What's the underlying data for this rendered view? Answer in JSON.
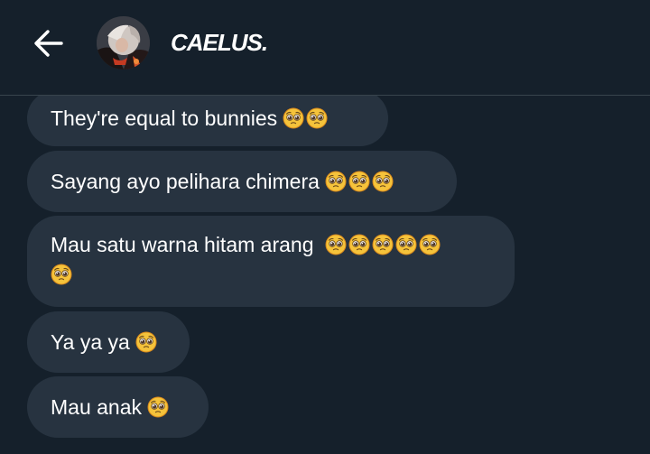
{
  "header": {
    "back_icon": "arrow-left-icon",
    "contact_name": "CAELUS."
  },
  "emoji": {
    "name": "pleading-face-emoji",
    "face_color": "#f5c33b",
    "outline_color": "#d98a1c"
  },
  "messages": [
    {
      "text": "They're equal to bunnies",
      "emoji_count": 2
    },
    {
      "text": "Sayang ayo pelihara chimera",
      "emoji_count": 3
    },
    {
      "text": "Mau satu warna hitam arang",
      "emoji_count": 6
    },
    {
      "text": "Ya ya ya",
      "emoji_count": 1
    },
    {
      "text": "Mau anak",
      "emoji_count": 1
    }
  ],
  "colors": {
    "background": "#15202b",
    "bubble": "#273340",
    "divider": "#38444d",
    "text": "#ffffff"
  }
}
